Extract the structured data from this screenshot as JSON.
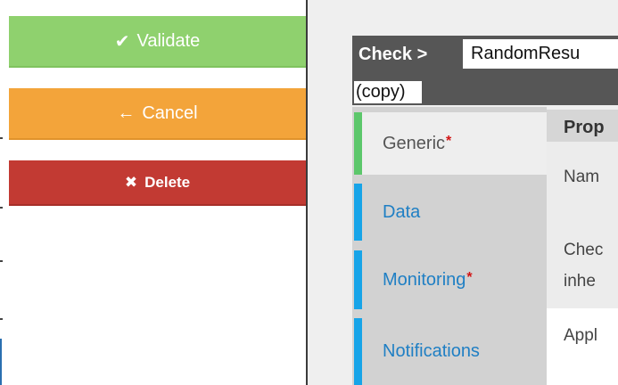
{
  "actions": {
    "validate": {
      "label": "Validate",
      "icon": "check-icon",
      "color": "#8fd16e"
    },
    "cancel": {
      "label": "Cancel",
      "icon": "arrow-left-icon",
      "color": "#f3a43a"
    },
    "delete": {
      "label": "Delete",
      "icon": "close-icon",
      "color": "#c23a33"
    }
  },
  "breadcrumb": {
    "section": "Check >",
    "name_line1": "RandomResu",
    "name_line2": "(copy)"
  },
  "tabs": [
    {
      "label": "Generic",
      "required": true,
      "active": true,
      "accent": "#5cc76b"
    },
    {
      "label": "Data",
      "required": false,
      "active": false,
      "accent": "#17a4e8"
    },
    {
      "label": "Monitoring",
      "required": true,
      "active": false,
      "accent": "#17a4e8"
    },
    {
      "label": "Notifications",
      "required": false,
      "active": false,
      "accent": "#17a4e8"
    }
  ],
  "required_marker": "*",
  "properties": {
    "header": "Prop",
    "rows": [
      "Nam",
      "Chec",
      "inhe",
      "Appl"
    ]
  }
}
